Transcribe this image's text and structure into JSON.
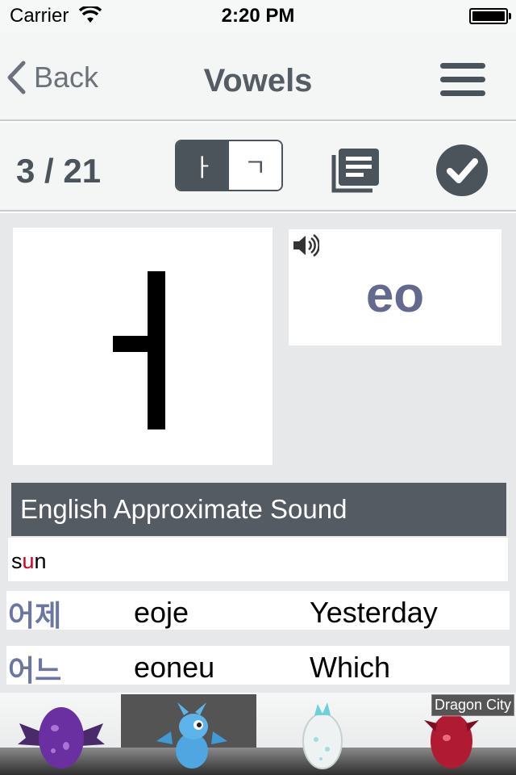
{
  "status_bar": {
    "carrier": "Carrier",
    "time": "2:20 PM",
    "wifi_icon": "wifi-icon",
    "battery_icon": "battery-icon"
  },
  "nav": {
    "back_label": "Back",
    "title": "Vowels",
    "menu_icon": "hamburger-menu-icon"
  },
  "toolbar": {
    "counter": "3 / 21",
    "segment_options": [
      "ㅏ",
      "ㄱ"
    ],
    "selected_segment": "ㅏ",
    "list_icon": "flashcard-list-icon",
    "check_icon": "checkmark-circle-icon"
  },
  "card": {
    "character": "ㅓ",
    "romanization": "eo",
    "speaker_icon": "speaker-icon"
  },
  "approximation": {
    "header": "English Approximate Sound",
    "word_before": "s",
    "word_highlight": "u",
    "word_after": "n"
  },
  "examples": [
    {
      "korean": "어제",
      "romanization": "eoje",
      "english": "Yesterday"
    },
    {
      "korean": "어느",
      "romanization": "eoneu",
      "english": "Which"
    }
  ],
  "ad": {
    "label": "Dragon City",
    "items": [
      "purple-egg-icon",
      "blue-dragon-icon",
      "white-egg-icon",
      "red-egg-icon"
    ]
  },
  "colors": {
    "accent_dark": "#4b535b",
    "header_bg": "#545b63",
    "romanization": "#63698f",
    "korean_word": "#6c76a2",
    "highlight": "#d0021b"
  }
}
